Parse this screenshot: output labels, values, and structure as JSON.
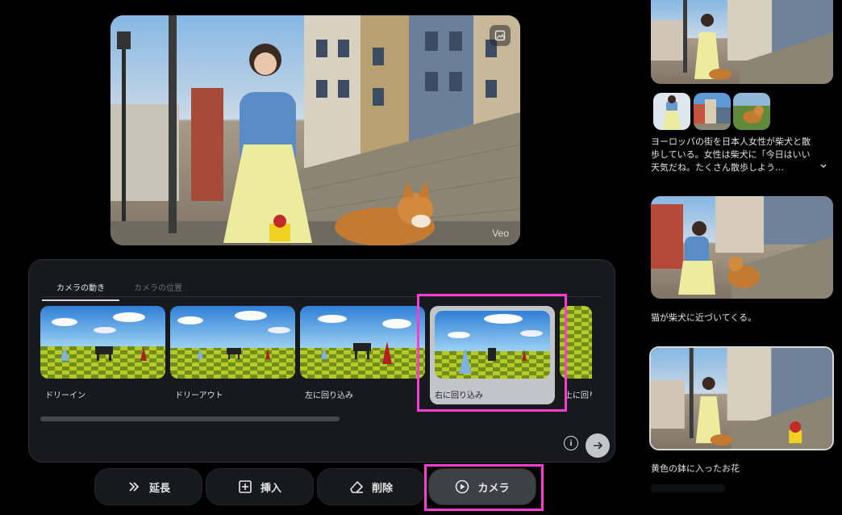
{
  "preview": {
    "watermark": "Veo"
  },
  "camera_panel": {
    "tabs": [
      {
        "label": "カメラの動き",
        "active": true
      },
      {
        "label": "カメラの位置",
        "active": false
      }
    ],
    "options": [
      {
        "label": "ドリーイン"
      },
      {
        "label": "ドリーアウト"
      },
      {
        "label": "左に回り込み"
      },
      {
        "label": "右に回り込み",
        "selected": true
      },
      {
        "label": "上に回り込み"
      }
    ],
    "scroll_progress": 0.53
  },
  "actions": [
    {
      "label": "延長",
      "icon": "double-chevron-right-icon"
    },
    {
      "label": "挿入",
      "icon": "plus-square-icon"
    },
    {
      "label": "削除",
      "icon": "eraser-icon"
    },
    {
      "label": "カメラ",
      "icon": "play-circle-icon",
      "active": true
    }
  ],
  "sidebar": {
    "prompt_text": "ヨーロッパの街を日本人女性が柴犬と散歩している。女性は柴犬に「今日はいい天気だね。たくさん散歩しよう…",
    "clips": [
      {
        "caption": "猫が柴犬に近づいてくる。"
      },
      {
        "caption": "黄色の鉢に入ったお花"
      }
    ]
  },
  "colors": {
    "highlight": "#ff3cd2",
    "panel_bg": "#17191c",
    "active_button": "#3e4044"
  }
}
